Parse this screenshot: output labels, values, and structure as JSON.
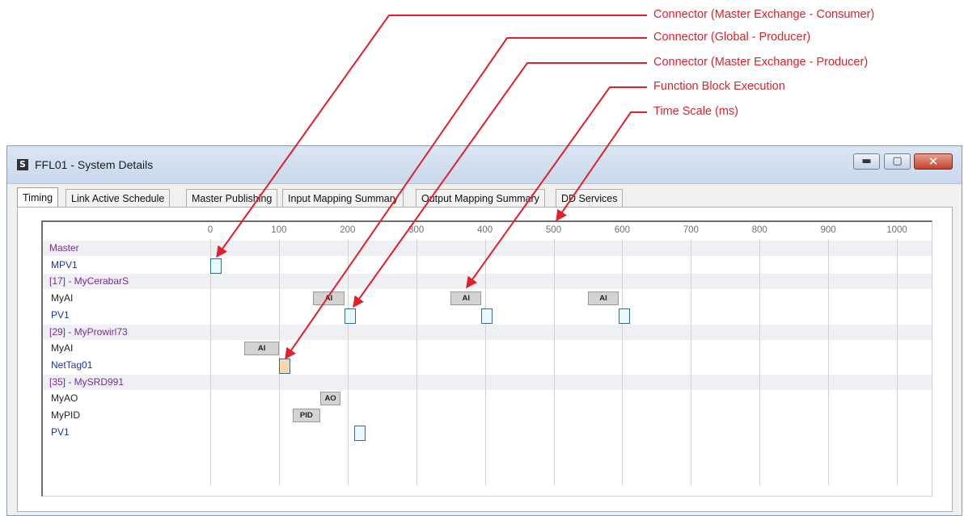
{
  "annotations": [
    {
      "label": "Connector (Master Exchange - Consumer)"
    },
    {
      "label": "Connector (Global - Producer)"
    },
    {
      "label": "Connector (Master Exchange - Producer)"
    },
    {
      "label": "Function Block Execution"
    },
    {
      "label": "Time Scale (ms)"
    }
  ],
  "window": {
    "icon_letter": "S",
    "title": "FFL01 - System Details",
    "buttons": {
      "minimize": "▬",
      "maximize": "▢",
      "close": "✕"
    }
  },
  "tabs": [
    {
      "label": "Timing",
      "active": true
    },
    {
      "label": "Link Active Schedule"
    },
    {
      "label": "Master Publishing"
    },
    {
      "label": "Input Mapping Summary"
    },
    {
      "label": "Output Mapping Summary"
    },
    {
      "label": "DD Services"
    }
  ],
  "chart_data": {
    "type": "timing",
    "time_ticks": [
      0,
      100,
      200,
      300,
      400,
      500,
      600,
      700,
      800,
      900,
      1000
    ],
    "rows": [
      {
        "label": "Master",
        "kind": "header"
      },
      {
        "label": "MPV1",
        "kind": "connector",
        "items": [
          {
            "type": "consumer",
            "t": 0
          }
        ]
      },
      {
        "label": "[17] - MyCerabarS",
        "kind": "header"
      },
      {
        "label": "MyAI",
        "kind": "function_block",
        "items": [
          {
            "text": "AI",
            "start": 150,
            "end": 195
          },
          {
            "text": "AI",
            "start": 350,
            "end": 395
          },
          {
            "text": "AI",
            "start": 550,
            "end": 595
          }
        ]
      },
      {
        "label": "PV1",
        "kind": "connector",
        "items": [
          {
            "type": "master_producer",
            "t": 195
          },
          {
            "type": "master_producer",
            "t": 395
          },
          {
            "type": "master_producer",
            "t": 595
          }
        ]
      },
      {
        "label": "[29] - MyProwirl73",
        "kind": "header"
      },
      {
        "label": "MyAI",
        "kind": "function_block",
        "items": [
          {
            "text": "AI",
            "start": 50,
            "end": 100
          }
        ]
      },
      {
        "label": "NetTag01",
        "kind": "connector",
        "items": [
          {
            "type": "global_producer",
            "t": 100
          }
        ]
      },
      {
        "label": "[35] - MySRD991",
        "kind": "header"
      },
      {
        "label": "MyAO",
        "kind": "function_block",
        "items": [
          {
            "text": "AO",
            "start": 160,
            "end": 190
          }
        ]
      },
      {
        "label": "MyPID",
        "kind": "function_block",
        "items": [
          {
            "text": "PID",
            "start": 120,
            "end": 160
          }
        ]
      },
      {
        "label": "PV1",
        "kind": "connector",
        "items": [
          {
            "type": "master_producer",
            "t": 210
          }
        ]
      }
    ],
    "connector_colors": {
      "consumer": "#e6fafd",
      "master_producer": "#e6fafd",
      "global_producer": "#f7d8a8"
    },
    "callout_color": "#e0202a"
  }
}
